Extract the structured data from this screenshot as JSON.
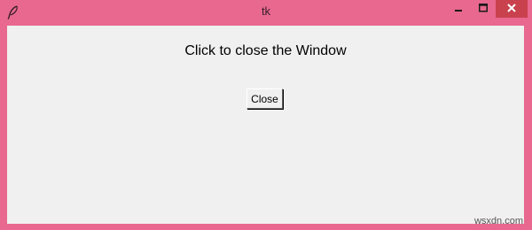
{
  "window": {
    "title": "tk",
    "icon": "feather-icon",
    "controls": {
      "minimize_icon": "minimize-icon",
      "maximize_icon": "maximize-icon",
      "close_icon": "close-icon"
    },
    "frame_color": "#e8688f",
    "close_hover_color": "#c9414d"
  },
  "content": {
    "heading": "Click to close the Window",
    "close_button_label": "Close",
    "background": "#f0f0f0"
  },
  "watermark": "wsxdn.com"
}
